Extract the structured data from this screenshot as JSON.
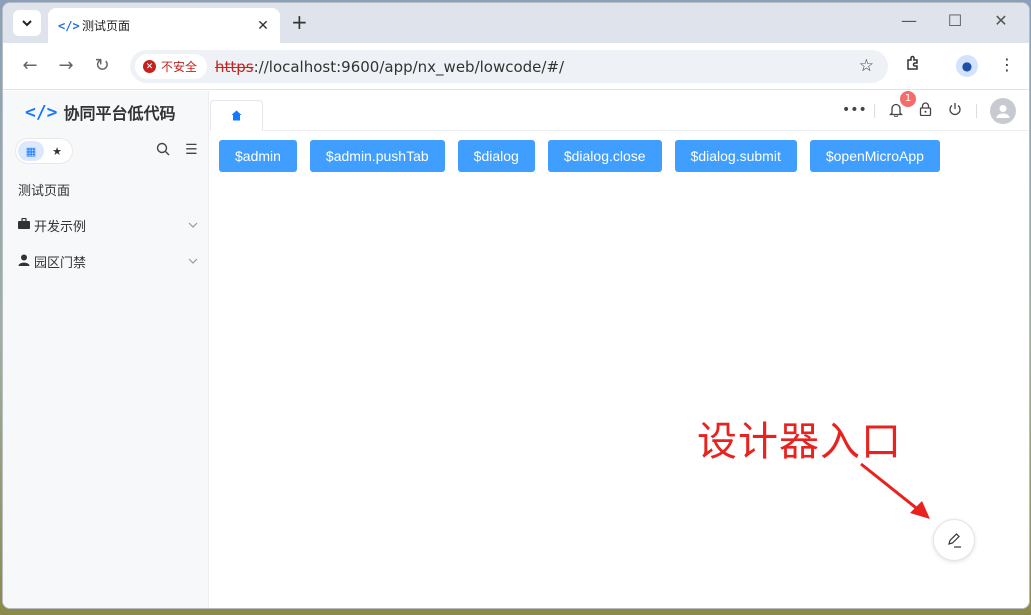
{
  "browser": {
    "tab_title": "测试页面",
    "tab_favicon": "</>",
    "new_tab": "+",
    "security_label": "不安全",
    "url_scheme": "https",
    "url_rest": "://localhost:9600/app/nx_web/lowcode/#/"
  },
  "app": {
    "brand": "协同平台低代码",
    "sidebar": {
      "items": [
        {
          "label": "测试页面"
        },
        {
          "label": "开发示例",
          "icon": "briefcase-icon"
        },
        {
          "label": "园区门禁",
          "icon": "person-icon"
        }
      ]
    },
    "header": {
      "notification_count": "1"
    },
    "buttons": [
      "$admin",
      "$admin.pushTab",
      "$dialog",
      "$dialog.close",
      "$dialog.submit",
      "$openMicroApp"
    ],
    "accent_color": "#409eff"
  },
  "annotation": {
    "text": "设计器入口",
    "color": "#e8231f"
  }
}
